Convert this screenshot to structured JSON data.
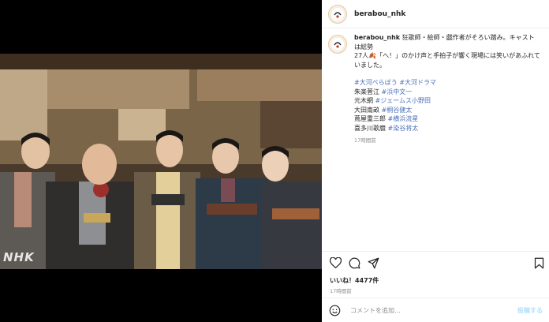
{
  "post": {
    "username": "berabou_nhk",
    "watermark": "NHK",
    "caption_lines": [
      "狂歌師・絵師・戯作者がそろい踏み。キャストは総勢",
      "27人🍂「へ！」のかけ声と手拍子が響く現場には笑いがあふれて",
      "いました。"
    ],
    "hashtags": [
      "#大河べらぼう",
      "#大河ドラマ"
    ],
    "credits": [
      {
        "role": "朱楽菅江",
        "actor": "#浜中文一"
      },
      {
        "role": "元木網",
        "actor": "#ジェームス小野田"
      },
      {
        "role": "大田南畝",
        "actor": "#桐谷健太"
      },
      {
        "role": "蔦屋重三郎",
        "actor": "#横浜流星"
      },
      {
        "role": "喜多川歌麿",
        "actor": "#染谷将太"
      }
    ],
    "caption_time": "17時間前",
    "likes": "いいね！4477件",
    "time": "17時間前"
  },
  "comment": {
    "placeholder": "コメントを追加...",
    "post_label": "投稿する"
  },
  "icons": {
    "like": "heart-icon",
    "comment": "comment-icon",
    "share": "share-icon",
    "save": "bookmark-icon",
    "emoji": "emoji-icon"
  },
  "colors": {
    "hashtag": "#4a6fb8",
    "post_button": "#b2dffc"
  }
}
